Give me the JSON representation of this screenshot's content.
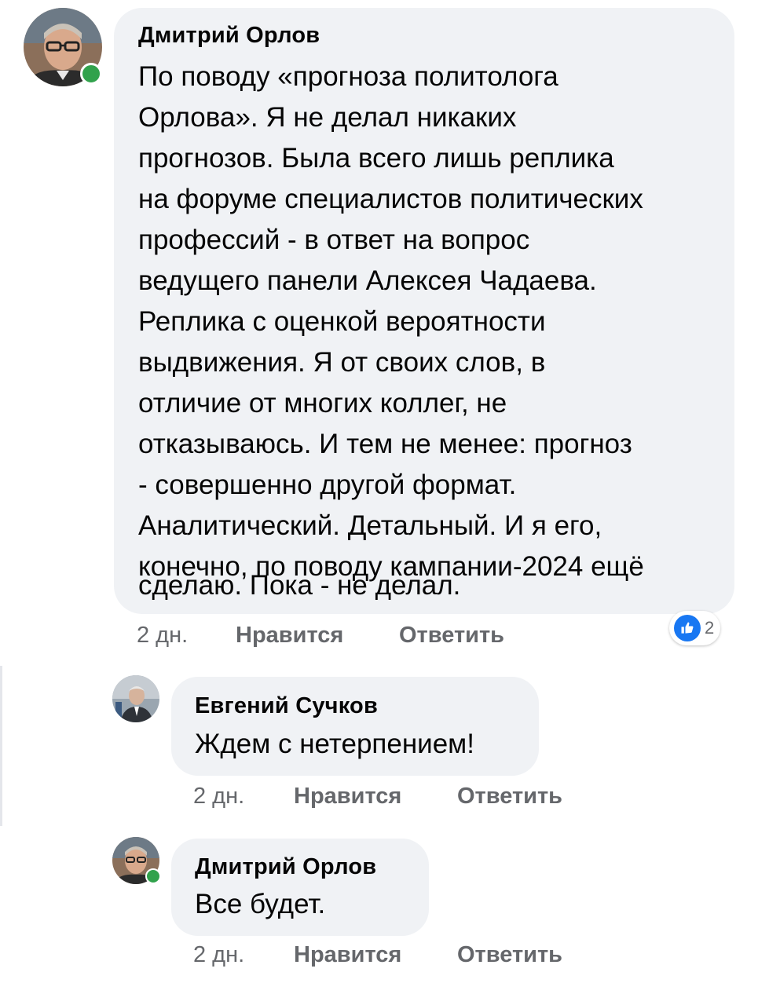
{
  "comments": [
    {
      "author": "Дмитрий Орлов",
      "lines": [
        "По поводу «прогноза политолога",
        "Орлова». Я не делал никаких",
        "прогнозов. Была всего лишь реплика",
        "на форуме специалистов политических",
        "профессий - в ответ на вопрос",
        "ведущего панели Алексея Чадаева.",
        "Реплика с оценкой вероятности",
        "выдвижения. Я от своих слов, в",
        "отличие от многих коллег, не",
        "отказываюсь. И тем не менее: прогноз",
        "- совершенно другой формат.",
        "Аналитический. Детальный. И я его,",
        "конечно, по поводу кампании-2024 ещё",
        "сделаю. Пока - не делал."
      ],
      "time": "2 дн.",
      "like_label": "Нравится",
      "reply_label": "Ответить",
      "reaction": {
        "icon": "like-icon",
        "count": "2",
        "color": "#1877f2"
      },
      "online": true
    },
    {
      "author": "Евгений Сучков",
      "lines": [
        "Ждем с нетерпением!"
      ],
      "time": "2 дн.",
      "like_label": "Нравится",
      "reply_label": "Ответить",
      "online": false
    },
    {
      "author": "Дмитрий Орлов",
      "lines": [
        "Все будет."
      ],
      "time": "2 дн.",
      "like_label": "Нравится",
      "reply_label": "Ответить",
      "online": true
    }
  ],
  "colors": {
    "bubble": "#f0f2f5",
    "meta_text": "#65676b",
    "online": "#31a24c",
    "like_blue": "#1877f2"
  }
}
